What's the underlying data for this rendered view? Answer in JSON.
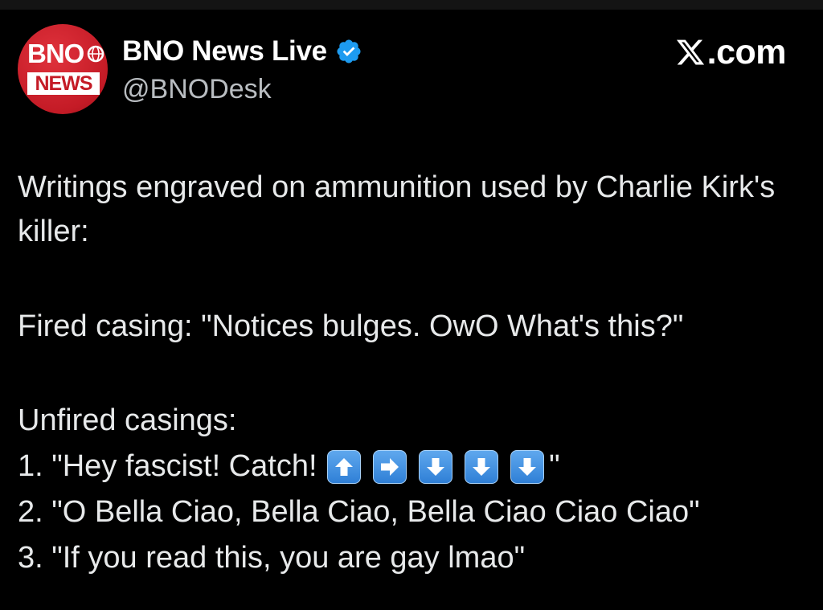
{
  "account": {
    "name": "BNO News Live",
    "handle": "@BNODesk",
    "avatar_top": "BNO",
    "avatar_bottom": "NEWS",
    "verified_icon": "verified-badge-icon",
    "avatar_color": "#c41b26",
    "verified_color": "#1d9bf0"
  },
  "brand": {
    "label": ".com",
    "icon": "x-logo-icon"
  },
  "post": {
    "intro": "Writings engraved on ammunition used by Charlie Kirk's killer:",
    "fired": "Fired casing: \"Notices bulges. OwO What's this?\"",
    "unfired_header": "Unfired casings:",
    "item1_prefix": "1. \"Hey fascist! Catch! ",
    "item1_arrows": [
      "up",
      "right",
      "down",
      "down",
      "down"
    ],
    "item1_suffix": "\"",
    "item2": "2. \"O Bella Ciao, Bella Ciao, Bella Ciao Ciao Ciao\"",
    "item3": "3. \"If you read this, you are gay lmao\""
  },
  "colors": {
    "background": "#000000",
    "text": "#e7e9ea",
    "handle": "#b9bdc1",
    "arrow_emoji": "#3b8ae0"
  }
}
